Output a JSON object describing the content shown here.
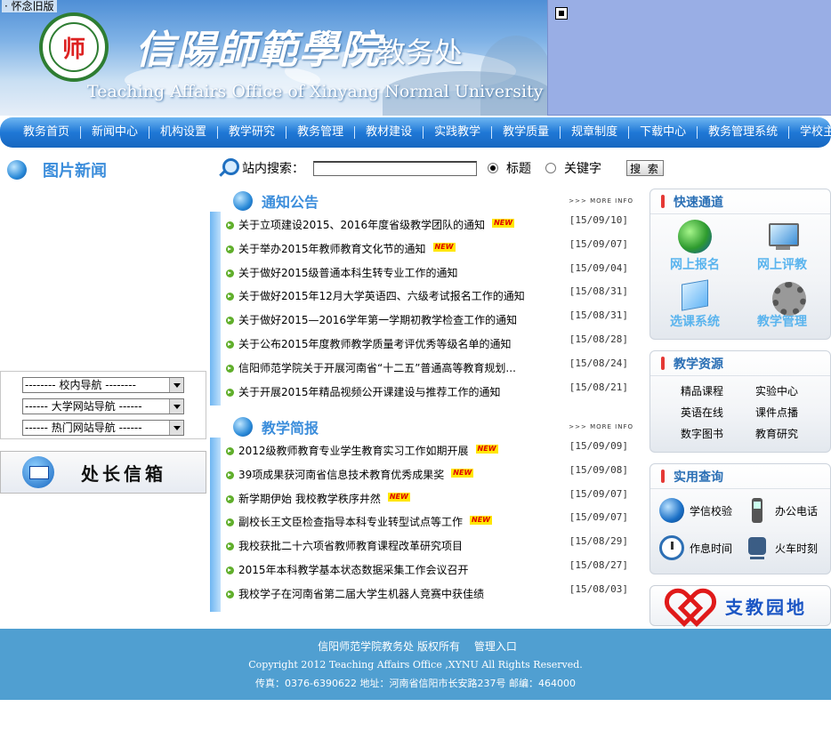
{
  "header": {
    "old_version_link": "· 怀念旧版",
    "logo_char": "师",
    "school_name": "信陽師範學院",
    "office_name": "教务处",
    "english_name": "Teaching Affairs Office of  Xinyang Normal University"
  },
  "nav": {
    "items": [
      "教务首页",
      "新闻中心",
      "机构设置",
      "教学研究",
      "教务管理",
      "教材建设",
      "实践教学",
      "教学质量",
      "规章制度",
      "下载中心",
      "教务管理系统",
      "学校主页"
    ]
  },
  "left": {
    "pic_news_title": "图片新闻",
    "selects": [
      "--------  校内导航  --------",
      "------  大学网站导航  ------",
      "------  热门网站导航  ------"
    ],
    "mailbox_label": "处长信箱"
  },
  "search": {
    "label": "站内搜索：",
    "value": "",
    "option_title": "标题",
    "option_keyword": "关键字",
    "button": "搜 索"
  },
  "notices": {
    "title": "通知公告",
    "more": ">>> MORE INFO",
    "items": [
      {
        "text": "关于立项建设2015、2016年度省级教学团队的通知",
        "new": "NEW",
        "date": "[15/09/10]"
      },
      {
        "text": "关于举办2015年教师教育文化节的通知",
        "new": "NEW",
        "date": "[15/09/07]"
      },
      {
        "text": "关于做好2015级普通本科生转专业工作的通知",
        "new": "",
        "date": "[15/09/04]"
      },
      {
        "text": "关于做好2015年12月大学英语四、六级考试报名工作的通知",
        "new": "",
        "date": "[15/08/31]"
      },
      {
        "text": "关于做好2015—2016学年第一学期初教学检查工作的通知",
        "new": "",
        "date": "[15/08/31]"
      },
      {
        "text": "关于公布2015年度教师教学质量考评优秀等级名单的通知",
        "new": "",
        "date": "[15/08/28]"
      },
      {
        "text": "信阳师范学院关于开展河南省“十二五”普通高等教育规划...",
        "new": "",
        "date": "[15/08/24]"
      },
      {
        "text": "关于开展2015年精品视频公开课建设与推荐工作的通知",
        "new": "",
        "date": "[15/08/21]"
      }
    ]
  },
  "briefs": {
    "title": "教学简报",
    "more": ">>> MORE INFO",
    "items": [
      {
        "text": "2012级教师教育专业学生教育实习工作如期开展",
        "new": "NEW",
        "date": "[15/09/09]"
      },
      {
        "text": "39项成果获河南省信息技术教育优秀成果奖",
        "new": "NEW",
        "date": "[15/09/08]"
      },
      {
        "text": "新学期伊始 我校教学秩序井然",
        "new": "NEW",
        "date": "[15/09/07]"
      },
      {
        "text": "副校长王文臣检查指导本科专业转型试点等工作",
        "new": "NEW",
        "date": "[15/09/07]"
      },
      {
        "text": "我校获批二十六项省教师教育课程改革研究项目",
        "new": "",
        "date": "[15/08/29]"
      },
      {
        "text": "2015年本科教学基本状态数据采集工作会议召开",
        "new": "",
        "date": "[15/08/27]"
      },
      {
        "text": "我校学子在河南省第二届大学生机器人竞赛中获佳绩",
        "new": "",
        "date": "[15/08/03]"
      }
    ]
  },
  "quick": {
    "title": "快速通道",
    "items": [
      {
        "label": "网上报名",
        "icon": "globe-doc-icon"
      },
      {
        "label": "网上评教",
        "icon": "monitor-icon"
      },
      {
        "label": "选课系统",
        "icon": "folder-icon"
      },
      {
        "label": "教学管理",
        "icon": "gear-icon"
      }
    ]
  },
  "resources": {
    "title": "教学资源",
    "items": [
      "精品课程",
      "实验中心",
      "英语在线",
      "课件点播",
      "数字图书",
      "教育研究"
    ]
  },
  "practical": {
    "title": "实用查询",
    "items": [
      {
        "label": "学信校验",
        "icon": "globe-icon"
      },
      {
        "label": "办公电话",
        "icon": "phone-icon"
      },
      {
        "label": "作息时间",
        "icon": "clock-icon"
      },
      {
        "label": "火车时刻",
        "icon": "train-icon"
      }
    ]
  },
  "teach_box_label": "支教园地",
  "footer": {
    "copyright_cn": "信阳师范学院教务处 版权所有",
    "admin_link": "管理入口",
    "copyright_en": "Copyright 2012 Teaching Affairs Office ,XYNU All Rights Reserved.",
    "contact": "传真：0376-6390622 地址：河南省信阳市长安路237号 邮编：464000"
  }
}
